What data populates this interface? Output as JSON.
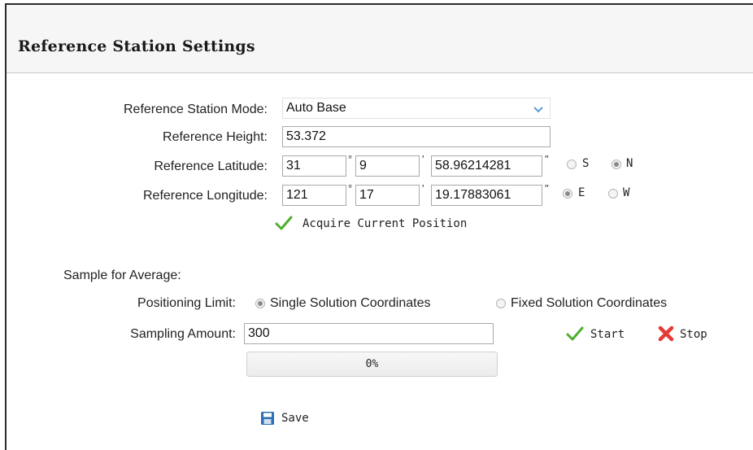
{
  "panel": {
    "title": "Reference Station Settings"
  },
  "reference": {
    "mode": {
      "label": "Reference Station Mode:",
      "value": "Auto Base"
    },
    "height": {
      "label": "Reference Height:",
      "value": "53.372"
    },
    "latitude": {
      "label": "Reference Latitude:",
      "degrees": "31",
      "minutes": "9",
      "seconds": "58.96214281",
      "hemisphere_options": [
        "S",
        "N"
      ],
      "selected": "N"
    },
    "longitude": {
      "label": "Reference Longitude:",
      "degrees": "121",
      "minutes": "17",
      "seconds": "19.17883061",
      "hemisphere_options": [
        "E",
        "W"
      ],
      "selected": "E"
    },
    "units": {
      "degree": "°",
      "minute": "'",
      "second": "\""
    },
    "acquire_label": "Acquire Current Position"
  },
  "sampling": {
    "section_label": "Sample for Average:",
    "positioning_limit": {
      "label": "Positioning Limit:",
      "options": [
        "Single Solution Coordinates",
        "Fixed Solution Coordinates"
      ],
      "selected": "Single Solution Coordinates"
    },
    "amount": {
      "label": "Sampling Amount:",
      "value": "300"
    },
    "start_label": "Start",
    "stop_label": "Stop",
    "progress": {
      "percent": 0,
      "text": "0%"
    }
  },
  "actions": {
    "save_label": "Save"
  },
  "colors": {
    "check_green": "#4caf2e",
    "stop_red": "#e53935",
    "save_blue": "#2f6fb5",
    "chevron_blue": "#5b9bd5"
  },
  "icons": {
    "acquire": "check-icon",
    "start": "check-icon",
    "stop": "x-icon",
    "save": "floppy-disk-icon",
    "dropdown": "chevron-down-icon"
  }
}
